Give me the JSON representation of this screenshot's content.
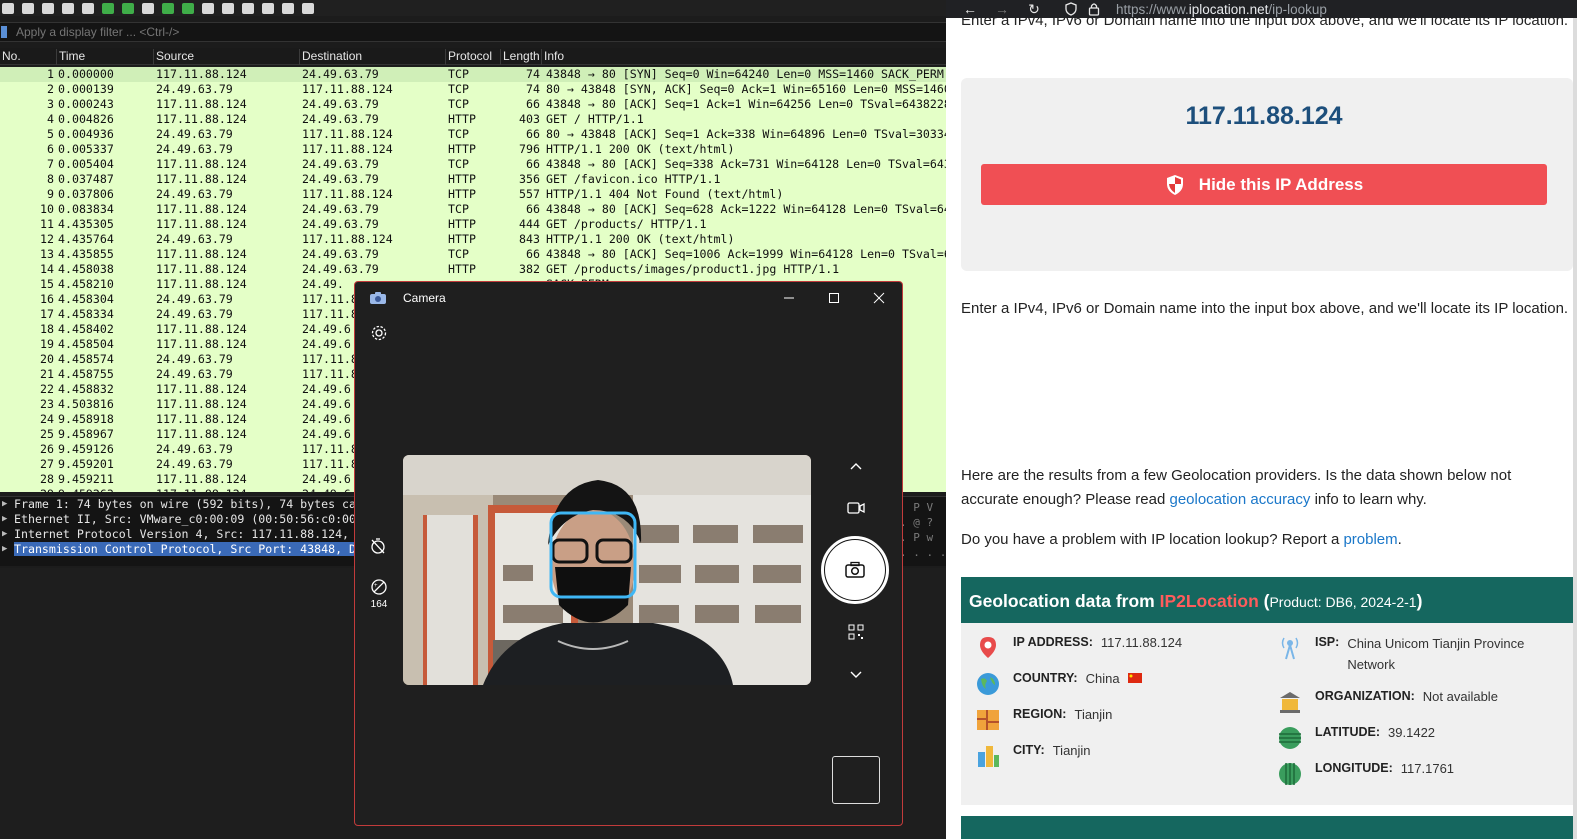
{
  "wireshark": {
    "filter_placeholder": "Apply a display filter ... <Ctrl-/>",
    "columns": [
      "No.",
      "Time",
      "Source",
      "Destination",
      "Protocol",
      "Length",
      "Info"
    ],
    "packets": [
      [
        "1",
        "0.000000",
        "117.11.88.124",
        "24.49.63.79",
        "TCP",
        "74",
        "43848 → 80 [SYN] Seq=0 Win=64240 Len=0 MSS=1460 SACK_PERM"
      ],
      [
        "2",
        "0.000139",
        "24.49.63.79",
        "117.11.88.124",
        "TCP",
        "74",
        "80 → 43848 [SYN, ACK] Seq=0 Ack=1 Win=65160 Len=0 MSS=1460"
      ],
      [
        "3",
        "0.000243",
        "117.11.88.124",
        "24.49.63.79",
        "TCP",
        "66",
        "43848 → 80 [ACK] Seq=1 Ack=1 Win=64256 Len=0 TSval=6438228"
      ],
      [
        "4",
        "0.004826",
        "117.11.88.124",
        "24.49.63.79",
        "HTTP",
        "403",
        "GET / HTTP/1.1"
      ],
      [
        "5",
        "0.004936",
        "24.49.63.79",
        "117.11.88.124",
        "TCP",
        "66",
        "80 → 43848 [ACK] Seq=1 Ack=338 Win=64896 Len=0 TSval=30334"
      ],
      [
        "6",
        "0.005337",
        "24.49.63.79",
        "117.11.88.124",
        "HTTP",
        "796",
        "HTTP/1.1 200 OK  (text/html)"
      ],
      [
        "7",
        "0.005404",
        "117.11.88.124",
        "24.49.63.79",
        "TCP",
        "66",
        "43848 → 80 [ACK] Seq=338 Ack=731 Win=64128 Len=0 TSval=643"
      ],
      [
        "8",
        "0.037487",
        "117.11.88.124",
        "24.49.63.79",
        "HTTP",
        "356",
        "GET /favicon.ico HTTP/1.1"
      ],
      [
        "9",
        "0.037806",
        "24.49.63.79",
        "117.11.88.124",
        "HTTP",
        "557",
        "HTTP/1.1 404 Not Found  (text/html)"
      ],
      [
        "10",
        "0.083834",
        "117.11.88.124",
        "24.49.63.79",
        "TCP",
        "66",
        "43848 → 80 [ACK] Seq=628 Ack=1222 Win=64128 Len=0 TSval=64"
      ],
      [
        "11",
        "4.435305",
        "117.11.88.124",
        "24.49.63.79",
        "HTTP",
        "444",
        "GET /products/ HTTP/1.1"
      ],
      [
        "12",
        "4.435764",
        "24.49.63.79",
        "117.11.88.124",
        "HTTP",
        "843",
        "HTTP/1.1 200 OK  (text/html)"
      ],
      [
        "13",
        "4.435855",
        "117.11.88.124",
        "24.49.63.79",
        "TCP",
        "66",
        "43848 → 80 [ACK] Seq=1006 Ack=1999 Win=64128 Len=0 TSval=6"
      ],
      [
        "14",
        "4.458038",
        "117.11.88.124",
        "24.49.63.79",
        "HTTP",
        "382",
        "GET /products/images/product1.jpg HTTP/1.1"
      ],
      [
        "15",
        "4.458210",
        "117.11.88.124",
        "24.49.",
        "",
        "",
        "                                                  SACK_PERM"
      ],
      [
        "16",
        "4.458304",
        "24.49.63.79",
        "117.11.8",
        "",
        "",
        "                                                  SS=1460"
      ],
      [
        "17",
        "4.458334",
        "24.49.63.79",
        "117.11.8",
        "",
        "",
        ""
      ],
      [
        "18",
        "4.458402",
        "117.11.88.124",
        "24.49.6",
        "",
        "",
        "                                                  6438273"
      ],
      [
        "19",
        "4.458504",
        "117.11.88.124",
        "24.49.6",
        "",
        "",
        ""
      ],
      [
        "20",
        "4.458574",
        "24.49.63.79",
        "117.11.8",
        "",
        "",
        "                                                  l=30334"
      ],
      [
        "21",
        "4.458755",
        "24.49.63.79",
        "117.11.8",
        "",
        "",
        ""
      ],
      [
        "22",
        "4.458832",
        "117.11.88.124",
        "24.49.6",
        "",
        "",
        "                                                  val=643"
      ],
      [
        "23",
        "4.503816",
        "117.11.88.124",
        "24.49.6",
        "",
        "",
        "                                                  TSval=6"
      ],
      [
        "24",
        "9.458918",
        "117.11.88.124",
        "24.49.6",
        "",
        "",
        "                                                  =0 TSva"
      ],
      [
        "25",
        "9.458967",
        "117.11.88.124",
        "24.49.6",
        "",
        "",
        "                                                  en=0 TS"
      ],
      [
        "26",
        "9.459126",
        "24.49.63.79",
        "117.11.8",
        "",
        "",
        "                                                  =0 TSva"
      ],
      [
        "27",
        "9.459201",
        "24.49.63.79",
        "117.11.8",
        "",
        "",
        "                                                  en=0 TS"
      ],
      [
        "28",
        "9.459211",
        "117.11.88.124",
        "24.49.6",
        "",
        "",
        "                                                  val=643"
      ],
      [
        "29",
        "9.459263",
        "117.11.88.124",
        "24.49.6",
        "",
        "",
        ""
      ]
    ],
    "details": [
      "Frame 1: 74 bytes on wire (592 bits), 74 bytes ca",
      "Ethernet II, Src: VMware_c0:00:09 (00:50:56:c0:00",
      "Internet Protocol Version 4, Src: 117.11.88.124,",
      "Transmission Control Protocol, Src Port: 43848, D"
    ],
    "hex_fragment": "  P V\n. @ ?\n. P w\n. . . ."
  },
  "camera": {
    "title": "Camera",
    "timer_badge": "164"
  },
  "browser": {
    "url_prefix": "https://www.",
    "url_domain": "iplocation.net",
    "url_path": "/ip-lookup",
    "cut_text": "Enter a IPv4, IPv6 or Domain name into the input box above, and we'll locate its IP location.",
    "ip_value": "117.11.88.124",
    "hide_button": "Hide this IP Address",
    "intro": "Enter a IPv4, IPv6 or Domain name into the input box above, and we'll locate its IP location.",
    "results_text_1": "Here are the results from a few Geolocation providers. Is the data shown below not accurate enough? Please read ",
    "results_link": "geolocation accuracy",
    "results_text_2": " info to learn why.",
    "problem_text": "Do you have a problem with IP location lookup? Report a ",
    "problem_link": "problem",
    "problem_end": ".",
    "geo_title_1": "Geolocation data from ",
    "geo_brand": "IP2Location",
    "geo_title_2": " (",
    "geo_product": "Product: DB6, 2024-2-1",
    "geo_title_3": ")",
    "fields": {
      "ip_label": "IP ADDRESS:",
      "ip": "117.11.88.124",
      "country_label": "COUNTRY:",
      "country": "China",
      "region_label": "REGION:",
      "region": "Tianjin",
      "city_label": "CITY:",
      "city": "Tianjin",
      "isp_label": "ISP:",
      "isp": "China Unicom Tianjin Province Network",
      "org_label": "ORGANIZATION:",
      "org": "Not available",
      "lat_label": "LATITUDE:",
      "lat": "39.1422",
      "lon_label": "LONGITUDE:",
      "lon": "117.1761"
    }
  }
}
